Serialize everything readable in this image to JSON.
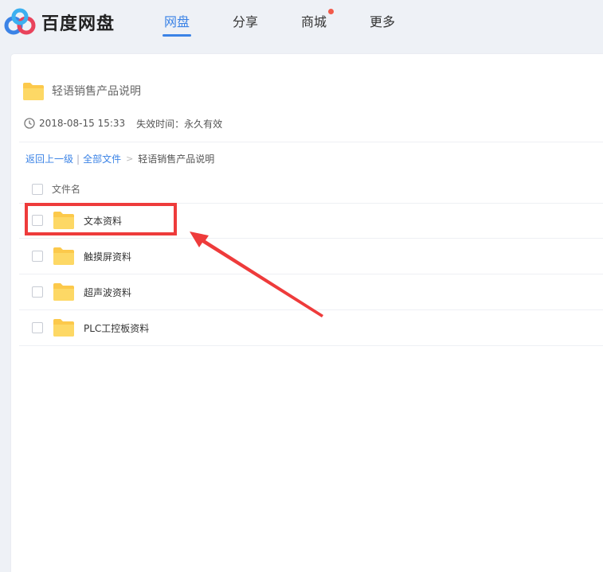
{
  "header": {
    "logo_text": "百度网盘",
    "nav": [
      {
        "label": "网盘",
        "active": true
      },
      {
        "label": "分享",
        "active": false
      },
      {
        "label": "商城",
        "active": false,
        "badge_dot": true
      },
      {
        "label": "更多",
        "active": false
      }
    ]
  },
  "share": {
    "title": "轻语销售产品说明",
    "created": "2018-08-15 15:33",
    "expire_label": "失效时间：永久有效"
  },
  "breadcrumb": {
    "back": "返回上一级",
    "separator": "|",
    "all_files": "全部文件",
    "arrow": ">",
    "current": "轻语销售产品说明"
  },
  "file_list": {
    "column_header": "文件名",
    "rows": [
      {
        "name": "文本资料",
        "type": "folder",
        "highlighted": true
      },
      {
        "name": "触摸屏资料",
        "type": "folder",
        "highlighted": false
      },
      {
        "name": "超声波资料",
        "type": "folder",
        "highlighted": false
      },
      {
        "name": "PLC工控板资料",
        "type": "folder",
        "highlighted": false
      }
    ]
  },
  "colors": {
    "accent": "#3b83e6",
    "folder": "#fcc94b",
    "annotation_red": "#ee3b3b",
    "badge_dot": "#f25a4a"
  }
}
